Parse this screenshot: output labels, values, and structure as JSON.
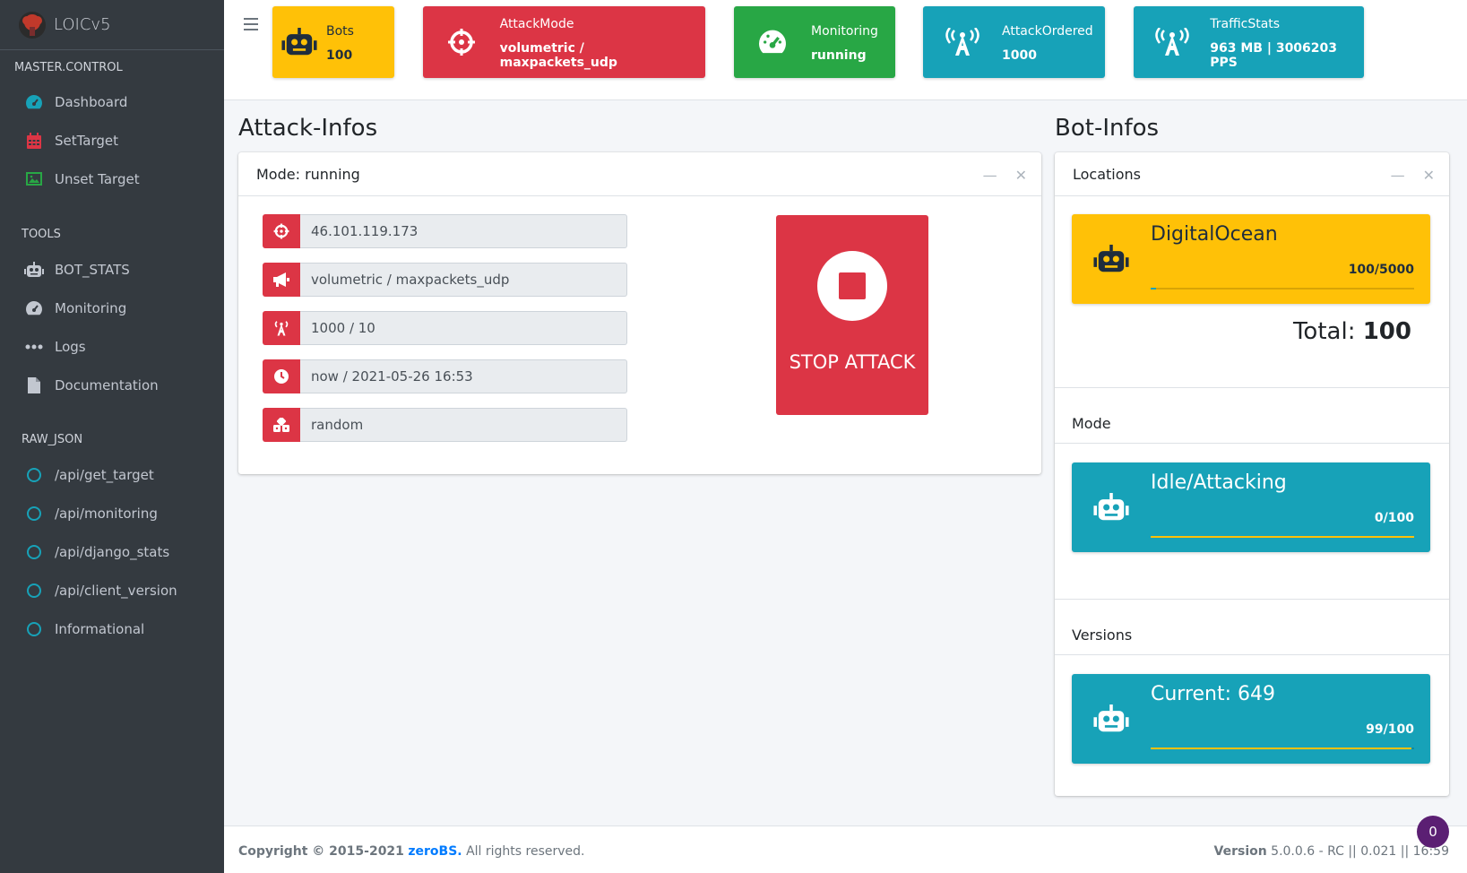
{
  "brand": {
    "name": "LOICv5"
  },
  "sidebar": {
    "sections": [
      {
        "header": "MASTER.CONTROL",
        "items": [
          {
            "label": "Dashboard",
            "icon": "gauge-icon"
          },
          {
            "label": "SetTarget",
            "icon": "calendar-icon"
          },
          {
            "label": "Unset Target",
            "icon": "image-icon"
          }
        ]
      },
      {
        "header": "TOOLS",
        "items": [
          {
            "label": "BOT_STATS",
            "icon": "robot-icon"
          },
          {
            "label": "Monitoring",
            "icon": "gauge-icon"
          },
          {
            "label": "Logs",
            "icon": "ellipsis-icon"
          },
          {
            "label": "Documentation",
            "icon": "file-icon"
          }
        ]
      },
      {
        "header": "RAW_JSON",
        "items": [
          {
            "label": "/api/get_target",
            "icon": "circle-icon"
          },
          {
            "label": "/api/monitoring",
            "icon": "circle-icon"
          },
          {
            "label": "/api/django_stats",
            "icon": "circle-icon"
          },
          {
            "label": "/api/client_version",
            "icon": "circle-icon"
          },
          {
            "label": "Informational",
            "icon": "circle-icon"
          }
        ]
      }
    ]
  },
  "topbar": {
    "boxes": [
      {
        "title": "Bots",
        "value": "100",
        "color": "#ffc107",
        "text_color": "#1f2d3d",
        "icon": "robot-icon"
      },
      {
        "title": "AttackMode",
        "value": "volumetric / maxpackets_udp",
        "color": "#dc3545",
        "text_color": "#ffffff",
        "icon": "crosshairs-icon"
      },
      {
        "title": "Monitoring",
        "value": "running",
        "color": "#28a745",
        "text_color": "#ffffff",
        "icon": "gauge-icon"
      },
      {
        "title": "AttackOrdered",
        "value": "1000",
        "color": "#17a2b8",
        "text_color": "#ffffff",
        "icon": "broadcast-tower-icon"
      },
      {
        "title": "TrafficStats",
        "value": "963 MB | 3006203 PPS",
        "color": "#17a2b8",
        "text_color": "#ffffff",
        "icon": "broadcast-tower-icon"
      }
    ]
  },
  "attack": {
    "section_title": "Attack-Infos",
    "card_title": "Mode: running",
    "fields": [
      {
        "value": "46.101.119.173",
        "icon": "crosshairs-icon"
      },
      {
        "value": "volumetric / maxpackets_udp",
        "icon": "megaphone-icon"
      },
      {
        "value": "1000 / 10",
        "icon": "broadcast-tower-icon"
      },
      {
        "value": "now / 2021-05-26 16:53",
        "icon": "clock-icon"
      },
      {
        "value": "random",
        "icon": "dice-icon"
      }
    ],
    "stop_label": "STOP ATTACK"
  },
  "bots": {
    "section_title": "Bot-Infos",
    "card_title": "Locations",
    "location": {
      "name": "DigitalOcean",
      "count": "100/5000",
      "fraction": 0.02
    },
    "total_label": "Total:",
    "total_value": "100",
    "mode_header": "Mode",
    "mode": {
      "name": "Idle/Attacking",
      "count": "0/100",
      "fraction": 1.0
    },
    "versions_header": "Versions",
    "version": {
      "name": "Current: 649",
      "count": "99/100",
      "fraction": 0.99
    }
  },
  "footer": {
    "copyright": "Copyright © 2015-2021",
    "company": "zeroBS.",
    "rights": "All rights reserved.",
    "version_label": "Version",
    "version_value": "5.0.0.6 - RC || 0.021 || 16:59"
  },
  "badge": {
    "count": "0"
  },
  "colors": {
    "sidebar_bg": "#343a40",
    "danger": "#dc3545",
    "warning": "#ffc107",
    "info": "#17a2b8",
    "success": "#28a745"
  }
}
